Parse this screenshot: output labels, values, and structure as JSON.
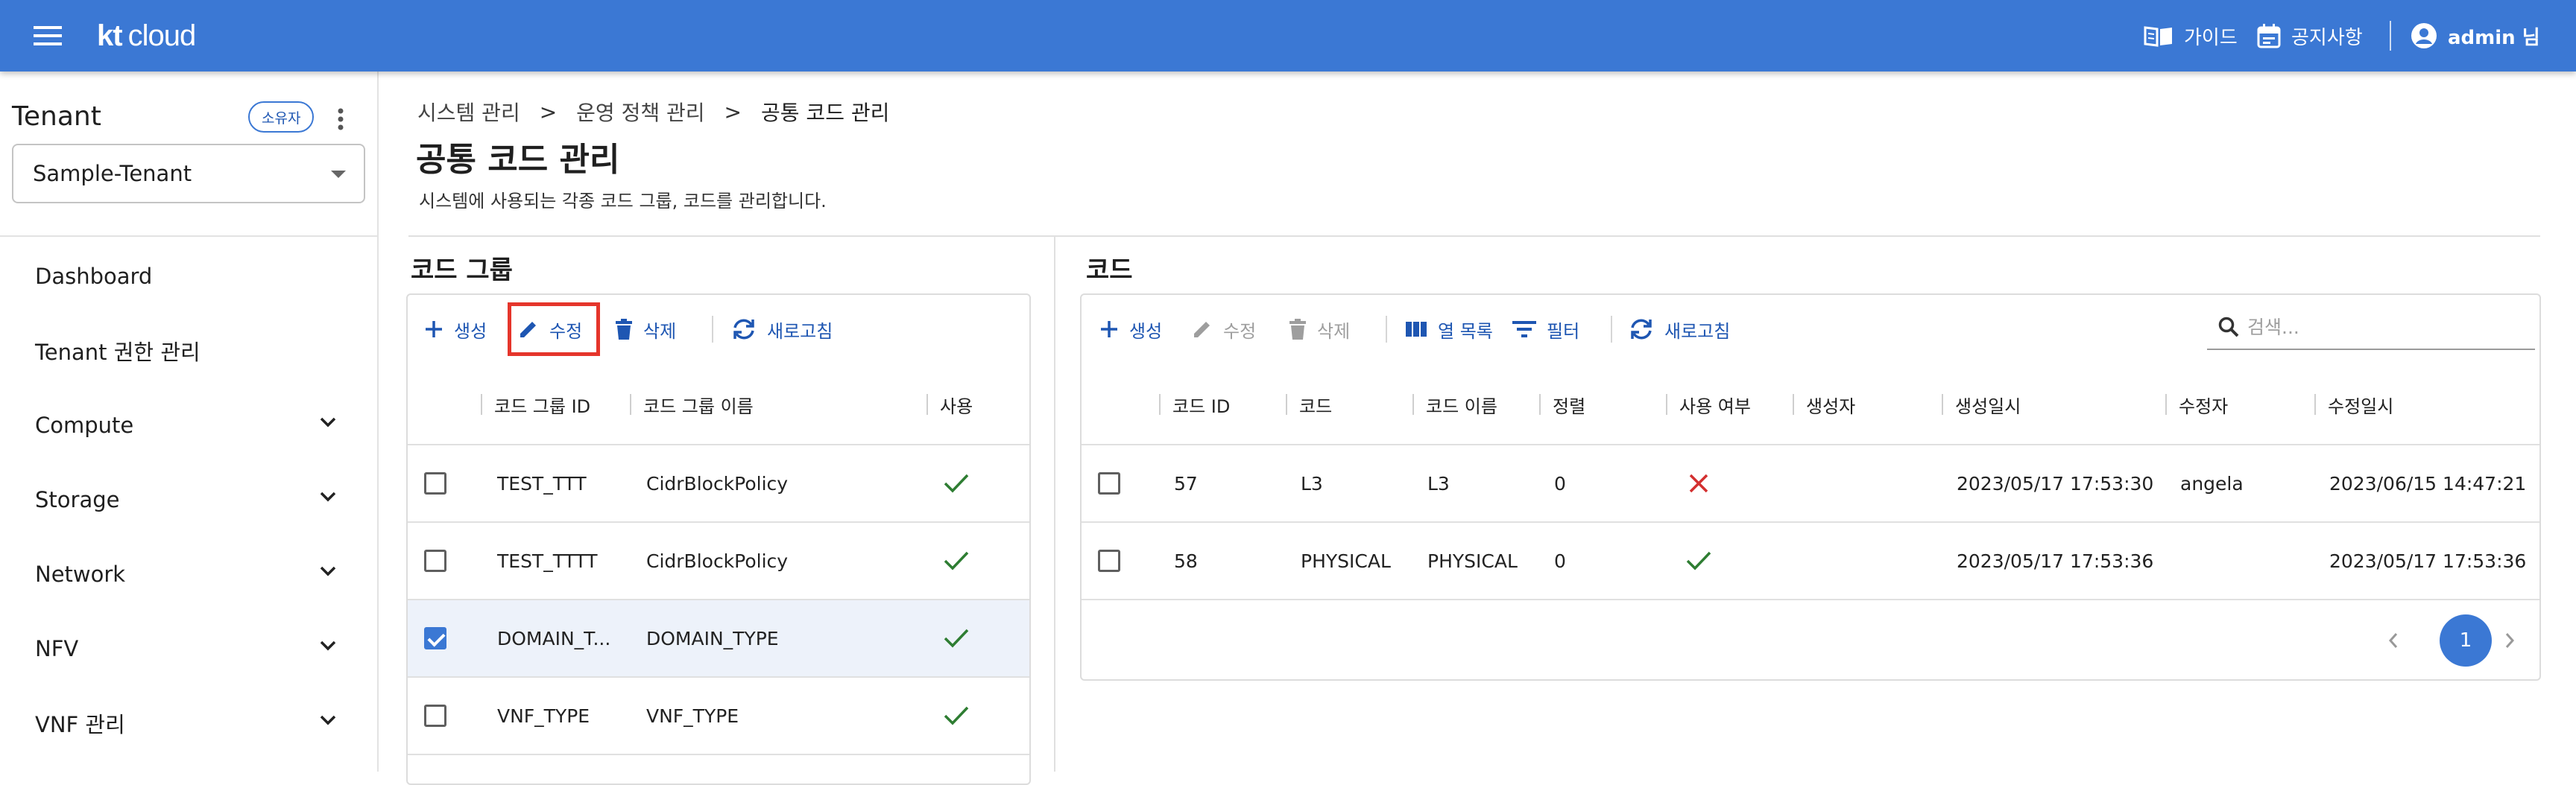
{
  "topbar": {
    "brand": "kt",
    "brand_suffix": "cloud",
    "guide_label": "가이드",
    "notice_label": "공지사항",
    "user_label": "admin 님",
    "color": "#3b78d4"
  },
  "sidebar": {
    "tenant_title": "Tenant",
    "owner_badge": "소유자",
    "tenant_selected": "Sample-Tenant",
    "items": [
      {
        "label": "Dashboard",
        "expandable": false
      },
      {
        "label": "Tenant 권한 관리",
        "expandable": false
      },
      {
        "label": "Compute",
        "expandable": true
      },
      {
        "label": "Storage",
        "expandable": true
      },
      {
        "label": "Network",
        "expandable": true
      },
      {
        "label": "NFV",
        "expandable": true
      },
      {
        "label": "VNF 관리",
        "expandable": true
      }
    ]
  },
  "breadcrumb": {
    "items": [
      "시스템 관리",
      "운영 정책 관리",
      "공통 코드 관리"
    ],
    "separator": ">"
  },
  "page": {
    "title": "공통 코드 관리",
    "description": "시스템에 사용되는 각종 코드 그룹, 코드를 관리합니다."
  },
  "code_group": {
    "title": "코드 그룹",
    "toolbar": {
      "create": "생성",
      "edit": "수정",
      "delete": "삭제",
      "refresh": "새로고침"
    },
    "columns": [
      "코드 그룹 ID",
      "코드 그룹 이름",
      "사용"
    ],
    "rows": [
      {
        "id": "TEST_TTT",
        "name": "CidrBlockPolicy",
        "used": true,
        "checked": false
      },
      {
        "id": "TEST_TTTT",
        "name": "CidrBlockPolicy",
        "used": true,
        "checked": false
      },
      {
        "id": "DOMAIN_T...",
        "name": "DOMAIN_TYPE",
        "used": true,
        "checked": true
      },
      {
        "id": "VNF_TYPE",
        "name": "VNF_TYPE",
        "used": true,
        "checked": false
      }
    ]
  },
  "code": {
    "title": "코드",
    "toolbar": {
      "create": "생성",
      "edit": "수정",
      "delete": "삭제",
      "columns": "열 목록",
      "filter": "필터",
      "refresh": "새로고침",
      "search_placeholder": "검색..."
    },
    "columns": [
      "코드 ID",
      "코드",
      "코드 이름",
      "정렬",
      "사용 여부",
      "생성자",
      "생성일시",
      "수정자",
      "수정일시"
    ],
    "rows": [
      {
        "id": "57",
        "code": "L3",
        "name": "L3",
        "order": "0",
        "used": false,
        "creator": "",
        "created": "2023/05/17 17:53:30",
        "modifier": "angela",
        "modified": "2023/06/15 14:47:21"
      },
      {
        "id": "58",
        "code": "PHYSICAL",
        "name": "PHYSICAL",
        "order": "0",
        "used": true,
        "creator": "",
        "created": "2023/05/17 17:53:36",
        "modifier": "",
        "modified": "2023/05/17 17:53:36"
      }
    ],
    "pagination": {
      "current_page": "1"
    }
  },
  "colors": {
    "primary": "#3b78d4",
    "link": "#1e56b2",
    "check_green": "#2e7d32",
    "cross_red": "#d32f2f",
    "highlight": "#e5352b",
    "selected_row": "#edf2fa"
  }
}
